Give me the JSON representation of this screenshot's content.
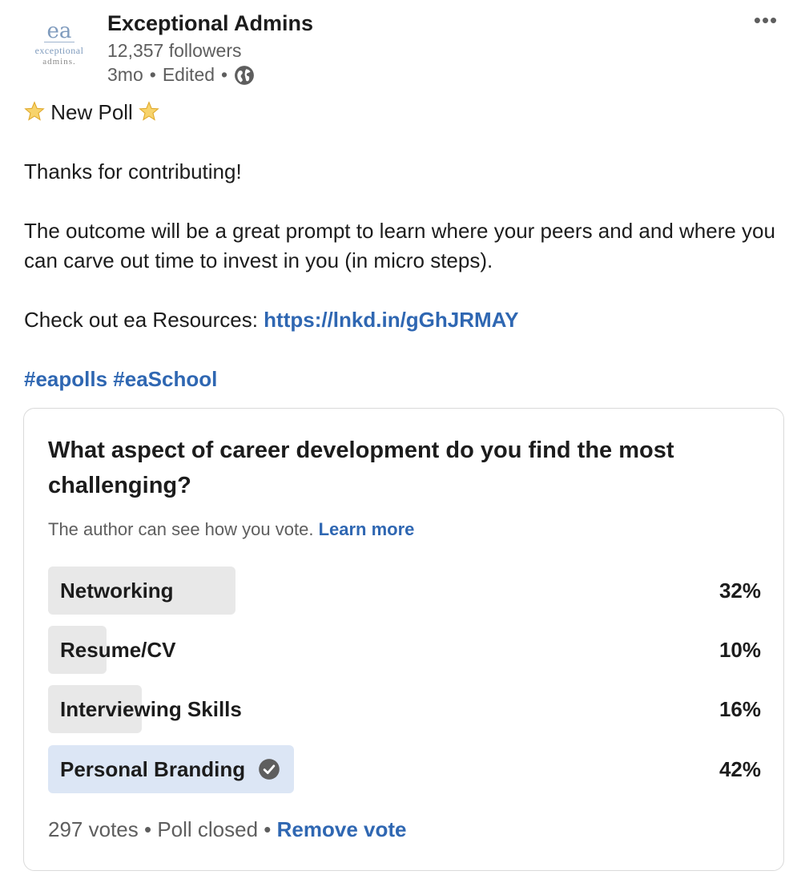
{
  "author": {
    "name": "Exceptional Admins",
    "followers": "12,357 followers",
    "age": "3mo",
    "edited": "Edited",
    "separator": "•",
    "logo": {
      "mark": "ea",
      "line1": "exceptional",
      "line2": "admins."
    }
  },
  "icons": {
    "more": "more-options-icon",
    "visibility": "globe-icon",
    "star": "star-emoji-icon",
    "voted": "check-circle-icon"
  },
  "post": {
    "title": "New Poll",
    "thanks": "Thanks for contributing!",
    "body": "The outcome will be a great prompt to learn where your peers and and where you can carve out time to invest in you (in micro steps).",
    "resources_prefix": "Check out ea Resources: ",
    "resources_link": "https://lnkd.in/gGhJRMAY",
    "hashtags": [
      "#eapolls",
      "#eaSchool"
    ]
  },
  "poll": {
    "question": "What aspect of career development do you find the most challenging?",
    "notice": "The author can see how you vote.",
    "learn_more": "Learn more",
    "options": [
      {
        "label": "Networking",
        "percent": "32%",
        "value": 32,
        "selected": false
      },
      {
        "label": "Resume/CV",
        "percent": "10%",
        "value": 10,
        "selected": false
      },
      {
        "label": "Interviewing Skills",
        "percent": "16%",
        "value": 16,
        "selected": false
      },
      {
        "label": "Personal Branding",
        "percent": "42%",
        "value": 42,
        "selected": true
      }
    ],
    "votes": "297 votes",
    "status": "Poll closed",
    "separator": "•",
    "remove_vote": "Remove vote"
  },
  "colors": {
    "link": "#2f67b2",
    "bar": "#e8e8e8",
    "bar_selected": "#dce6f5",
    "text": "#1c1c1c",
    "muted": "#5e5e5e"
  }
}
